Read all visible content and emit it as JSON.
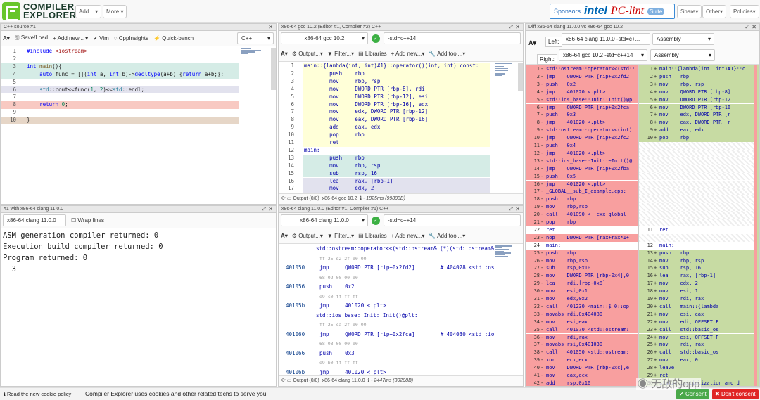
{
  "header": {
    "logo_line1": "COMPILER",
    "logo_line2": "EXPLORER",
    "add": "Add...",
    "more": "More",
    "sponsors_label": "Sponsors",
    "sponsor_intel": "intel",
    "sponsor_pclint": "PC-lint",
    "sponsor_suite": "Suite",
    "share": "Share",
    "other": "Other",
    "policies": "Policies"
  },
  "editor": {
    "title": "C++ source #1",
    "save": "Save/Load",
    "addnew": "+ Add new...",
    "vim": "Vim",
    "cppinsights": "CppInsights",
    "quickbench": "Quick-bench",
    "language": "C++",
    "lines": [
      "#include <iostream>",
      "",
      "int main(){",
      "    auto func = [](int a, int b)->decltype(a+b) {return a+b;};",
      "",
      "    std::cout<<func(1, 2)<<std::endl;",
      "",
      "    return 0;",
      "",
      "}"
    ]
  },
  "execpane": {
    "title": "#1 with x86-64 clang 11.0.0",
    "compiler": "x86-64 clang 11.0.0",
    "wrap": "Wrap lines",
    "output": [
      "ASM generation compiler returned: 0",
      "Execution build compiler returned: 0",
      "Program returned: 0",
      "  3"
    ]
  },
  "gccpane": {
    "title": "x86-64 gcc 10.2 (Editor #1, Compiler #2) C++",
    "compiler": "x86-64 gcc 10.2",
    "options": "-std=c++14",
    "output_btn": "Output...",
    "filter_btn": "Filter...",
    "libs_btn": "Libraries",
    "addnew_btn": "+ Add new...",
    "addtool_btn": "Add tool...",
    "lines": [
      "main::{lambda(int, int)#1}::operator()(int, int) const:",
      "        push    rbp",
      "        mov     rbp, rsp",
      "        mov     DWORD PTR [rbp-8], rdi",
      "        mov     DWORD PTR [rbp-12], esi",
      "        mov     DWORD PTR [rbp-16], edx",
      "        mov     edx, DWORD PTR [rbp-12]",
      "        mov     eax, DWORD PTR [rbp-16]",
      "        add     eax, edx",
      "        pop     rbp",
      "        ret",
      "main:",
      "        push    rbp",
      "        mov     rbp, rsp",
      "        sub     rsp, 16",
      "        lea     rax, [rbp-1]",
      "        mov     edx, 2"
    ],
    "status_output": "Output (0/0)",
    "status_compiler": "x86-64 gcc 10.2",
    "status_time": "- 1825ms (99803B)"
  },
  "clangpane": {
    "title": "x86-64 clang 11.0.0 (Editor #1, Compiler #1) C++",
    "compiler": "x86-64 clang 11.0.0",
    "options": "-std=c++14",
    "output_btn": "Output...",
    "filter_btn": "Filter...",
    "libs_btn": "Libraries",
    "addnew_btn": "+ Add new...",
    "addtool_btn": "Add tool...",
    "rows": [
      {
        "addr": "",
        "text": "std::ostream::operator<<(std::ostream& (*)(std::ostream&",
        "kind": "label"
      },
      {
        "addr": "",
        "text": "ff 25 d2 2f 00 00",
        "kind": "bytes"
      },
      {
        "addr": "401050",
        "text": "jmp     QWORD PTR [rip+0x2fd2]        # 404028 <std::os",
        "kind": "ins"
      },
      {
        "addr": "",
        "text": "68 02 00 00 00",
        "kind": "bytes"
      },
      {
        "addr": "401056",
        "text": "push    0x2",
        "kind": "ins"
      },
      {
        "addr": "",
        "text": "e9 c0 ff ff ff",
        "kind": "bytes"
      },
      {
        "addr": "40105b",
        "text": "jmp     401020 <.plt>",
        "kind": "ins"
      },
      {
        "addr": "",
        "text": "std::ios_base::Init::Init()@plt:",
        "kind": "label"
      },
      {
        "addr": "",
        "text": "ff 25 ca 2f 00 00",
        "kind": "bytes"
      },
      {
        "addr": "401060",
        "text": "jmp     QWORD PTR [rip+0x2fca]        # 404030 <std::io",
        "kind": "ins"
      },
      {
        "addr": "",
        "text": "68 03 00 00 00",
        "kind": "bytes"
      },
      {
        "addr": "401066",
        "text": "push    0x3",
        "kind": "ins"
      },
      {
        "addr": "",
        "text": "e9 b0 ff ff ff",
        "kind": "bytes"
      },
      {
        "addr": "40106b",
        "text": "jmp     401020 <.plt>",
        "kind": "ins"
      },
      {
        "addr": "",
        "text": "std::ostream::operator<<(int)@plt:",
        "kind": "label"
      },
      {
        "addr": "",
        "text": "ff 25 c2 2f 00 00",
        "kind": "bytes"
      },
      {
        "addr": "401070",
        "text": "jmp     QWORD PTR [rip+0x2fc2]        # 404038 <std::os",
        "kind": "ins"
      }
    ],
    "status_output": "Output (0/0)",
    "status_compiler": "x86-64 clang 11.0.0",
    "status_time": "- 2447ms (30208B)"
  },
  "diffpane": {
    "title": "Diff x86-64 clang 11.0.0 vs x86-64 gcc 10.2",
    "left_label": "Left:",
    "left_compiler": "x86-64 clang 11.0.0 -std=c+...",
    "left_type": "Assembly",
    "right_label": "Right:",
    "right_compiler": "x86-64 gcc 10.2 -std=c++14",
    "right_type": "Assembly",
    "left": [
      {
        "n": "1",
        "m": "-",
        "t": "std::ostream::operator<<(std::",
        "k": "del"
      },
      {
        "n": "2",
        "m": "-",
        "t": "jmp    QWORD PTR [rip+0x2fd2",
        "k": "del"
      },
      {
        "n": "3",
        "m": "-",
        "t": "push   0x2",
        "k": "del"
      },
      {
        "n": "4",
        "m": "-",
        "t": "jmp    401020 <.plt>",
        "k": "del"
      },
      {
        "n": "5",
        "m": "-",
        "t": "std::ios_base::Init::Init()@p",
        "k": "del"
      },
      {
        "n": "6",
        "m": "-",
        "t": "jmp    QWORD PTR [rip+0x2fca",
        "k": "del"
      },
      {
        "n": "7",
        "m": "-",
        "t": "push   0x3",
        "k": "del"
      },
      {
        "n": "8",
        "m": "-",
        "t": "jmp    401020 <.plt>",
        "k": "del"
      },
      {
        "n": "9",
        "m": "-",
        "t": "std::ostream::operator<<(int)",
        "k": "del"
      },
      {
        "n": "10",
        "m": "-",
        "t": "jmp    QWORD PTR [rip+0x2fc2",
        "k": "del"
      },
      {
        "n": "11",
        "m": "-",
        "t": "push   0x4",
        "k": "del"
      },
      {
        "n": "12",
        "m": "-",
        "t": "jmp    401020 <.plt>",
        "k": "del"
      },
      {
        "n": "13",
        "m": "-",
        "t": "std::ios_base::Init::~Init()@",
        "k": "del"
      },
      {
        "n": "14",
        "m": "-",
        "t": "jmp    QWORD PTR [rip+0x2fba",
        "k": "del"
      },
      {
        "n": "15",
        "m": "-",
        "t": "push   0x5",
        "k": "del"
      },
      {
        "n": "16",
        "m": "-",
        "t": "jmp    401020 <.plt>",
        "k": "del"
      },
      {
        "n": "17",
        "m": "-",
        "t": "_GLOBAL__sub_I_example.cpp:",
        "k": "del"
      },
      {
        "n": "18",
        "m": "-",
        "t": "push   rbp",
        "k": "del"
      },
      {
        "n": "19",
        "m": "-",
        "t": "mov    rbp,rsp",
        "k": "del"
      },
      {
        "n": "20",
        "m": "-",
        "t": "call   401090 <__cxx_global_",
        "k": "del"
      },
      {
        "n": "21",
        "m": "-",
        "t": "pop    rbp",
        "k": "del"
      },
      {
        "n": "22",
        "m": " ",
        "t": "ret",
        "k": "same"
      },
      {
        "n": "23",
        "m": "-",
        "t": "nop    DWORD PTR [rax+rax*1+",
        "k": "del"
      },
      {
        "n": "24",
        "m": " ",
        "t": "main:",
        "k": "same"
      },
      {
        "n": "25",
        "m": "-",
        "t": "push   rbp",
        "k": "del"
      },
      {
        "n": "26",
        "m": "-",
        "t": "mov    rbp,rsp",
        "k": "del"
      },
      {
        "n": "27",
        "m": "-",
        "t": "sub    rsp,0x10",
        "k": "del"
      },
      {
        "n": "28",
        "m": "-",
        "t": "mov    DWORD PTR [rbp-0x4],0",
        "k": "del"
      },
      {
        "n": "29",
        "m": "-",
        "t": "lea    rdi,[rbp-0x8]",
        "k": "del"
      },
      {
        "n": "30",
        "m": "-",
        "t": "mov    esi,0x1",
        "k": "del"
      },
      {
        "n": "31",
        "m": "-",
        "t": "mov    edx,0x2",
        "k": "del"
      },
      {
        "n": "32",
        "m": "-",
        "t": "call   401230 <main::$_0::op",
        "k": "del"
      },
      {
        "n": "33",
        "m": "-",
        "t": "movabs rdi,0x404080",
        "k": "del"
      },
      {
        "n": "34",
        "m": "-",
        "t": "mov    esi,eax",
        "k": "del"
      },
      {
        "n": "35",
        "m": "-",
        "t": "call   401070 <std::ostream:",
        "k": "del"
      },
      {
        "n": "36",
        "m": "-",
        "t": "mov    rdi,rax",
        "k": "del"
      },
      {
        "n": "37",
        "m": "-",
        "t": "movabs rsi,0x401030",
        "k": "del"
      },
      {
        "n": "38",
        "m": "-",
        "t": "call   401050 <std::ostream:",
        "k": "del"
      },
      {
        "n": "39",
        "m": "-",
        "t": "xor    ecx,ecx",
        "k": "del"
      },
      {
        "n": "40",
        "m": "-",
        "t": "mov    DWORD PTR [rbp-0xc],e",
        "k": "del"
      },
      {
        "n": "41",
        "m": "-",
        "t": "mov    eax,ecx",
        "k": "del"
      },
      {
        "n": "42",
        "m": "-",
        "t": "add    rsp,0x10",
        "k": "del"
      }
    ],
    "right": [
      {
        "n": "1",
        "m": "+",
        "t": "main::{lambda(int, int)#1}::o",
        "k": "add"
      },
      {
        "n": "2",
        "m": "+",
        "t": "push   rbp",
        "k": "add"
      },
      {
        "n": "3",
        "m": "+",
        "t": "mov    rbp, rsp",
        "k": "add"
      },
      {
        "n": "4",
        "m": "+",
        "t": "mov    QWORD PTR [rbp-8]",
        "k": "add"
      },
      {
        "n": "5",
        "m": "+",
        "t": "mov    DWORD PTR [rbp-12",
        "k": "add"
      },
      {
        "n": "6",
        "m": "+",
        "t": "mov    DWORD PTR [rbp-16",
        "k": "add"
      },
      {
        "n": "7",
        "m": "+",
        "t": "mov    edx, DWORD PTR [r",
        "k": "add"
      },
      {
        "n": "8",
        "m": "+",
        "t": "mov    eax, DWORD PTR [r",
        "k": "add"
      },
      {
        "n": "9",
        "m": "+",
        "t": "add    eax, edx",
        "k": "add"
      },
      {
        "n": "10",
        "m": "+",
        "t": "pop    rbp",
        "k": "add"
      },
      {
        "n": "",
        "m": "",
        "t": "",
        "k": "empty"
      },
      {
        "n": "",
        "m": "",
        "t": "",
        "k": "empty"
      },
      {
        "n": "",
        "m": "",
        "t": "",
        "k": "empty"
      },
      {
        "n": "",
        "m": "",
        "t": "",
        "k": "empty"
      },
      {
        "n": "",
        "m": "",
        "t": "",
        "k": "empty"
      },
      {
        "n": "",
        "m": "",
        "t": "",
        "k": "empty"
      },
      {
        "n": "",
        "m": "",
        "t": "",
        "k": "empty"
      },
      {
        "n": "",
        "m": "",
        "t": "",
        "k": "empty"
      },
      {
        "n": "",
        "m": "",
        "t": "",
        "k": "empty"
      },
      {
        "n": "",
        "m": "",
        "t": "",
        "k": "empty"
      },
      {
        "n": "",
        "m": "",
        "t": "",
        "k": "empty"
      },
      {
        "n": "11",
        "m": " ",
        "t": "ret",
        "k": "same"
      },
      {
        "n": "",
        "m": "",
        "t": "",
        "k": "empty"
      },
      {
        "n": "12",
        "m": " ",
        "t": "main:",
        "k": "same"
      },
      {
        "n": "13",
        "m": "+",
        "t": "push   rbp",
        "k": "add"
      },
      {
        "n": "14",
        "m": "+",
        "t": "mov    rbp, rsp",
        "k": "add"
      },
      {
        "n": "15",
        "m": "+",
        "t": "sub    rsp, 16",
        "k": "add"
      },
      {
        "n": "16",
        "m": "+",
        "t": "lea    rax, [rbp-1]",
        "k": "add"
      },
      {
        "n": "17",
        "m": "+",
        "t": "mov    edx, 2",
        "k": "add"
      },
      {
        "n": "18",
        "m": "+",
        "t": "mov    esi, 1",
        "k": "add"
      },
      {
        "n": "19",
        "m": "+",
        "t": "mov    rdi, rax",
        "k": "add"
      },
      {
        "n": "20",
        "m": "+",
        "t": "call   main::{lambda",
        "k": "add"
      },
      {
        "n": "21",
        "m": "+",
        "t": "mov    esi, eax",
        "k": "add"
      },
      {
        "n": "22",
        "m": "+",
        "t": "mov    edi, OFFSET F",
        "k": "add"
      },
      {
        "n": "23",
        "m": "+",
        "t": "call   std::basic_os",
        "k": "add"
      },
      {
        "n": "24",
        "m": "+",
        "t": "mov    esi, OFFSET F",
        "k": "add"
      },
      {
        "n": "25",
        "m": "+",
        "t": "mov    rdi, rax",
        "k": "add"
      },
      {
        "n": "26",
        "m": "+",
        "t": "call   std::basic_os",
        "k": "add"
      },
      {
        "n": "27",
        "m": "+",
        "t": "mov    eax, 0",
        "k": "add"
      },
      {
        "n": "28",
        "m": "+",
        "t": "leave",
        "k": "add"
      },
      {
        "n": "29",
        "m": "+",
        "t": "ret",
        "k": "add"
      },
      {
        "n": "30",
        "m": "+",
        "t": "static initialization and d",
        "k": "add"
      }
    ]
  },
  "cookie": {
    "readnew": "Read the new cookie policy",
    "message": "Compiler Explorer uses cookies and other related techs to serve you",
    "watermark": "无敌的cpp",
    "consent": "Consent",
    "dont": "Don't consent"
  },
  "colors": {
    "accent_green": "#67c52a",
    "diff_del": "#f89f9f",
    "diff_add": "#c7dba3",
    "hl_yellow": "#ffffd8",
    "hl_teal": "#d5ece6",
    "hl_lavender": "#e2e2ee",
    "hl_pink": "#f8c9c2",
    "hl_tan": "#e6d6c7"
  }
}
